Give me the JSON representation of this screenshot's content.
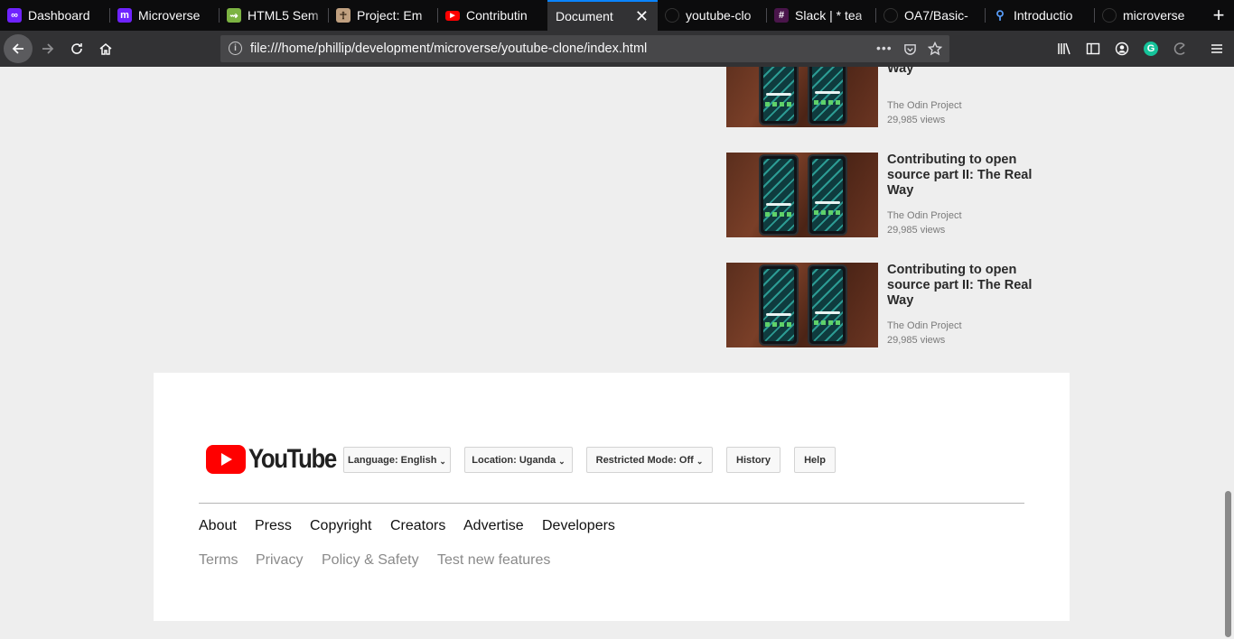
{
  "browser": {
    "tabs": [
      {
        "title": "Dashboard",
        "icon": "microverse-icon",
        "color": "#6f23ff"
      },
      {
        "title": "Microverse",
        "icon": "microverse-m-icon",
        "color": "#6f23ff"
      },
      {
        "title": "HTML5 Sem",
        "icon": "html5-sem-icon",
        "color": "#7cb342"
      },
      {
        "title": "Project: Em",
        "icon": "odin-icon",
        "color": "#c0a080"
      },
      {
        "title": "Contributin",
        "icon": "youtube-icon",
        "color": "#ff0000"
      },
      {
        "title": "Document",
        "icon": "",
        "color": ""
      },
      {
        "title": "youtube-clo",
        "icon": "github-icon",
        "color": "#333333"
      },
      {
        "title": "Slack | * tea",
        "icon": "slack-icon",
        "color": "#e01e5a"
      },
      {
        "title": "OA7/Basic-",
        "icon": "github-icon",
        "color": "#333333"
      },
      {
        "title": "Introductio",
        "icon": "network-icon",
        "color": "#5aa0ff"
      },
      {
        "title": "microverse",
        "icon": "github-icon",
        "color": "#333333"
      }
    ],
    "url": "file:///home/phillip/development/microverse/youtube-clone/index.html"
  },
  "videos": [
    {
      "title": "source part II: The Real Way",
      "channel": "The Odin Project",
      "views": "29,985 views"
    },
    {
      "title": "Contributing to open source part II: The Real Way",
      "channel": "The Odin Project",
      "views": "29,985 views"
    },
    {
      "title": "Contributing to open source part II: The Real Way",
      "channel": "The Odin Project",
      "views": "29,985 views"
    }
  ],
  "footer": {
    "logo_text": "YouTube",
    "language_label": "Language: English",
    "location_label": "Location: Uganda",
    "restricted_label": "Restricted Mode: Off",
    "history_label": "History",
    "help_label": "Help",
    "links_primary": [
      "About",
      "Press",
      "Copyright",
      "Creators",
      "Advertise",
      "Developers"
    ],
    "links_secondary": [
      "Terms",
      "Privacy",
      "Policy & Safety",
      "Test new features"
    ]
  },
  "colors": {
    "accent": "#0a84ff",
    "youtube_red": "#ff0000"
  }
}
